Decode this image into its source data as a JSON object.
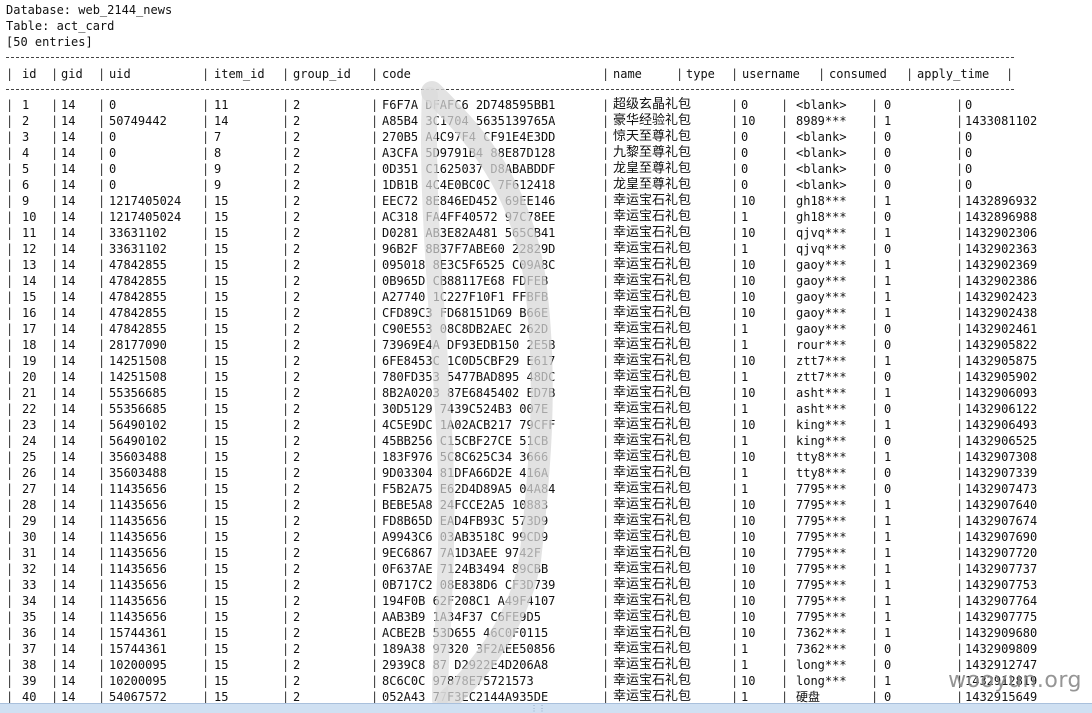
{
  "header": {
    "database_line": "Database: web_2144_news",
    "table_line": "Table: act_card",
    "entries_line": "[50 entries]"
  },
  "columns": [
    "id",
    "gid",
    "uid",
    "item_id",
    "group_id",
    "code",
    "name",
    "type",
    "username",
    "consumed",
    "apply_time"
  ],
  "rows": [
    [
      "1",
      "14",
      "0",
      "11",
      "2",
      "F6F7A  DFAFC6  2D748595BB1",
      "超级玄晶礼包",
      "0",
      "<blank>",
      "0",
      "0"
    ],
    [
      "2",
      "14",
      "50749442",
      "14",
      "2",
      "A85B4  3C1704  5635139765A",
      "豪华经验礼包",
      "10",
      "8989***",
      "1",
      "1433081102"
    ],
    [
      "3",
      "14",
      "0",
      "7",
      "2",
      "270B5  A4C97F4  CF91E4E3DD",
      "惊天至尊礼包",
      "0",
      "<blank>",
      "0",
      "0"
    ],
    [
      "4",
      "14",
      "0",
      "8",
      "2",
      "A3CFA  5D9791B4  88E87D128",
      "九黎至尊礼包",
      "0",
      "<blank>",
      "0",
      "0"
    ],
    [
      "5",
      "14",
      "0",
      "9",
      "2",
      "0D351  C1625037  D8ABABDDF",
      "龙皇至尊礼包",
      "0",
      "<blank>",
      "0",
      "0"
    ],
    [
      "6",
      "14",
      "0",
      "9",
      "2",
      "1DB1B  4C4E0BC0C  7F612418",
      "龙皇至尊礼包",
      "0",
      "<blank>",
      "0",
      "0"
    ],
    [
      "9",
      "14",
      "1217405024",
      "15",
      "2",
      "EEC72  8E846ED452  69EE146",
      "幸运宝石礼包",
      "10",
      "gh18***",
      "1",
      "1432896932"
    ],
    [
      "10",
      "14",
      "1217405024",
      "15",
      "2",
      "AC318  FA4FF40572  97C78EE",
      "幸运宝石礼包",
      "1",
      "gh18***",
      "0",
      "1432896988"
    ],
    [
      "11",
      "14",
      "33631102",
      "15",
      "2",
      "D0281  AB3E82A481  565CB41",
      "幸运宝石礼包",
      "10",
      "qjvq***",
      "1",
      "1432902306"
    ],
    [
      "12",
      "14",
      "33631102",
      "15",
      "2",
      "96B2F  8B37F7ABE60  22829D",
      "幸运宝石礼包",
      "1",
      "qjvq***",
      "0",
      "1432902363"
    ],
    [
      "13",
      "14",
      "47842855",
      "15",
      "2",
      "095018  8E3C5F6525  C09A8C",
      "幸运宝石礼包",
      "10",
      "gaoy***",
      "1",
      "1432902369"
    ],
    [
      "14",
      "14",
      "47842855",
      "15",
      "2",
      "0B965D  CB88117E68  FDFEB",
      "幸运宝石礼包",
      "10",
      "gaoy***",
      "1",
      "1432902386"
    ],
    [
      "15",
      "14",
      "47842855",
      "15",
      "2",
      "A27740  1C227F10F1  FFBFB",
      "幸运宝石礼包",
      "10",
      "gaoy***",
      "1",
      "1432902423"
    ],
    [
      "16",
      "14",
      "47842855",
      "15",
      "2",
      "CFD89C3  FD68151D69  B66E",
      "幸运宝石礼包",
      "10",
      "gaoy***",
      "1",
      "1432902438"
    ],
    [
      "17",
      "14",
      "47842855",
      "15",
      "2",
      "C90E553  08C8DB2AEC  262D",
      "幸运宝石礼包",
      "1",
      "gaoy***",
      "0",
      "1432902461"
    ],
    [
      "18",
      "14",
      "28177090",
      "15",
      "2",
      "73969E4A  DF93EDB150  2E5B",
      "幸运宝石礼包",
      "1",
      "rour***",
      "0",
      "1432905822"
    ],
    [
      "19",
      "14",
      "14251508",
      "15",
      "2",
      "6FE8453C  1C0D5CBF29  E617",
      "幸运宝石礼包",
      "10",
      "ztt7***",
      "1",
      "1432905875"
    ],
    [
      "20",
      "14",
      "14251508",
      "15",
      "2",
      "780FD353  5477BAD895  48DC",
      "幸运宝石礼包",
      "1",
      "ztt7***",
      "0",
      "1432905902"
    ],
    [
      "21",
      "14",
      "55356685",
      "15",
      "2",
      "8B2A0203  87E6845402  ED7B",
      "幸运宝石礼包",
      "10",
      "asht***",
      "1",
      "1432906093"
    ],
    [
      "22",
      "14",
      "55356685",
      "15",
      "2",
      "30D5129  7439C524B3  007E",
      "幸运宝石礼包",
      "1",
      "asht***",
      "0",
      "1432906122"
    ],
    [
      "23",
      "14",
      "56490102",
      "15",
      "2",
      "4C5E9DC  1A02ACB217  79CFF",
      "幸运宝石礼包",
      "10",
      "king***",
      "1",
      "1432906493"
    ],
    [
      "24",
      "14",
      "56490102",
      "15",
      "2",
      "45BB256  C15CBF27CE  51CB",
      "幸运宝石礼包",
      "1",
      "king***",
      "0",
      "1432906525"
    ],
    [
      "25",
      "14",
      "35603488",
      "15",
      "2",
      "183F976  5C8C625C34  3666",
      "幸运宝石礼包",
      "10",
      "tty8***",
      "1",
      "1432907308"
    ],
    [
      "26",
      "14",
      "35603488",
      "15",
      "2",
      "9D03304  81DFA66D2E  416A",
      "幸运宝石礼包",
      "1",
      "tty8***",
      "0",
      "1432907339"
    ],
    [
      "27",
      "14",
      "11435656",
      "15",
      "2",
      "F5B2A75  E62D4D89A5  04A84",
      "幸运宝石礼包",
      "1",
      "7795***",
      "0",
      "1432907473"
    ],
    [
      "28",
      "14",
      "11435656",
      "15",
      "2",
      "BEBE5A8  24FCCE2A5  10883",
      "幸运宝石礼包",
      "10",
      "7795***",
      "1",
      "1432907640"
    ],
    [
      "29",
      "14",
      "11435656",
      "15",
      "2",
      "FD8B65D  EAD4FB93C  573D9",
      "幸运宝石礼包",
      "10",
      "7795***",
      "1",
      "1432907674"
    ],
    [
      "30",
      "14",
      "11435656",
      "15",
      "2",
      "A9943C6  03AB3518C  99CD9",
      "幸运宝石礼包",
      "10",
      "7795***",
      "1",
      "1432907690"
    ],
    [
      "31",
      "14",
      "11435656",
      "15",
      "2",
      "9EC6867  7A1D3AEE  9742F",
      "幸运宝石礼包",
      "10",
      "7795***",
      "1",
      "1432907720"
    ],
    [
      "32",
      "14",
      "11435656",
      "15",
      "2",
      "0F637AE  7124B3494  89CBB",
      "幸运宝石礼包",
      "10",
      "7795***",
      "1",
      "1432907737"
    ],
    [
      "33",
      "14",
      "11435656",
      "15",
      "2",
      "0B717C2  08E838D6  CF3D739",
      "幸运宝石礼包",
      "10",
      "7795***",
      "1",
      "1432907753"
    ],
    [
      "34",
      "14",
      "11435656",
      "15",
      "2",
      "194F0B  62F208C1  A49F4107",
      "幸运宝石礼包",
      "10",
      "7795***",
      "1",
      "1432907764"
    ],
    [
      "35",
      "14",
      "11435656",
      "15",
      "2",
      "AAB3B9  1A34F37  C6FE9D5",
      "幸运宝石礼包",
      "10",
      "7795***",
      "1",
      "1432907775"
    ],
    [
      "36",
      "14",
      "15744361",
      "15",
      "2",
      "ACBE2B  53D655  46C0F0115",
      "幸运宝石礼包",
      "10",
      "7362***",
      "1",
      "1432909680"
    ],
    [
      "37",
      "14",
      "15744361",
      "15",
      "2",
      "189A38  97320  3F2AEE50856",
      "幸运宝石礼包",
      "1",
      "7362***",
      "0",
      "1432909809"
    ],
    [
      "38",
      "14",
      "10200095",
      "15",
      "2",
      "2939C8  87  D2922E4D206A8",
      "幸运宝石礼包",
      "1",
      "long***",
      "0",
      "1432912747"
    ],
    [
      "39",
      "14",
      "10200095",
      "15",
      "2",
      "8C6C0C  97878E75721573",
      "幸运宝石礼包",
      "10",
      "long***",
      "1",
      "1432912819"
    ],
    [
      "40",
      "14",
      "54067572",
      "15",
      "2",
      "052A43  77F3EC2144A935DE",
      "幸运宝石礼包",
      "1",
      "硬盘",
      "0",
      "1432915649"
    ]
  ],
  "watermark": "wooyun.org",
  "colors": {
    "background": "#ffffff",
    "text": "#111111",
    "statusbar": "#cfe0f2"
  }
}
